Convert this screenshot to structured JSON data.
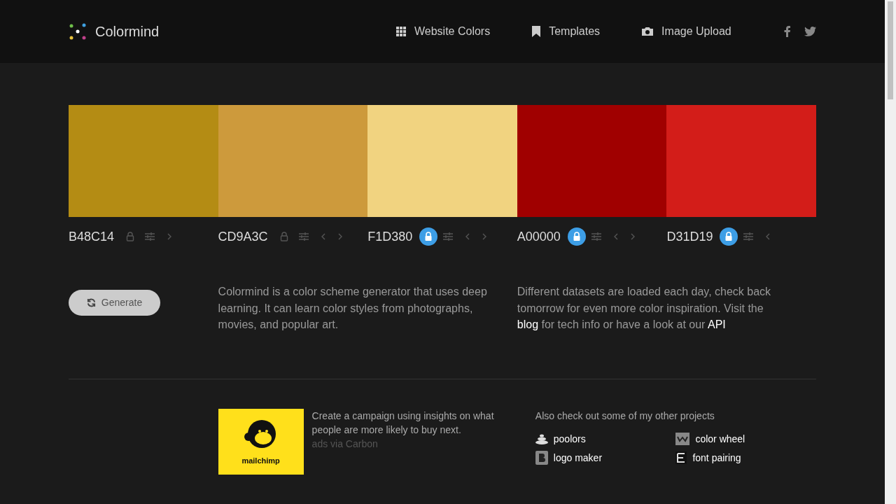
{
  "brand": {
    "name": "Colormind"
  },
  "nav": [
    {
      "label": "Website Colors"
    },
    {
      "label": "Templates"
    },
    {
      "label": "Image Upload"
    }
  ],
  "swatches": [
    {
      "hex": "B48C14",
      "color": "#b48c14",
      "locked": false,
      "prev": false,
      "next": true
    },
    {
      "hex": "CD9A3C",
      "color": "#cd9a3c",
      "locked": false,
      "prev": true,
      "next": true
    },
    {
      "hex": "F1D380",
      "color": "#f1d380",
      "locked": true,
      "prev": true,
      "next": true
    },
    {
      "hex": "A00000",
      "color": "#a00000",
      "locked": true,
      "prev": true,
      "next": true
    },
    {
      "hex": "D31D19",
      "color": "#d31d19",
      "locked": true,
      "prev": true,
      "next": false
    }
  ],
  "generate_button": "Generate",
  "intro": "Colormind is a color scheme generator that uses deep learning. It can learn color styles from photographs, movies, and popular art.",
  "info": {
    "text": "Different datasets are loaded each day, check back tomorrow for even more color inspiration. Visit the",
    "link1": "blog",
    "middle": "for tech info or have a look at our",
    "link2": "API"
  },
  "ad": {
    "brand": "mailchimp",
    "text": "Create a campaign using insights on what people are more likely to buy next.",
    "via": "ads via Carbon"
  },
  "projects": {
    "title": "Also check out some of my other projects",
    "items": [
      {
        "label": "poolors"
      },
      {
        "label": "color wheel"
      },
      {
        "label": "logo maker"
      },
      {
        "label": "font pairing"
      }
    ]
  }
}
